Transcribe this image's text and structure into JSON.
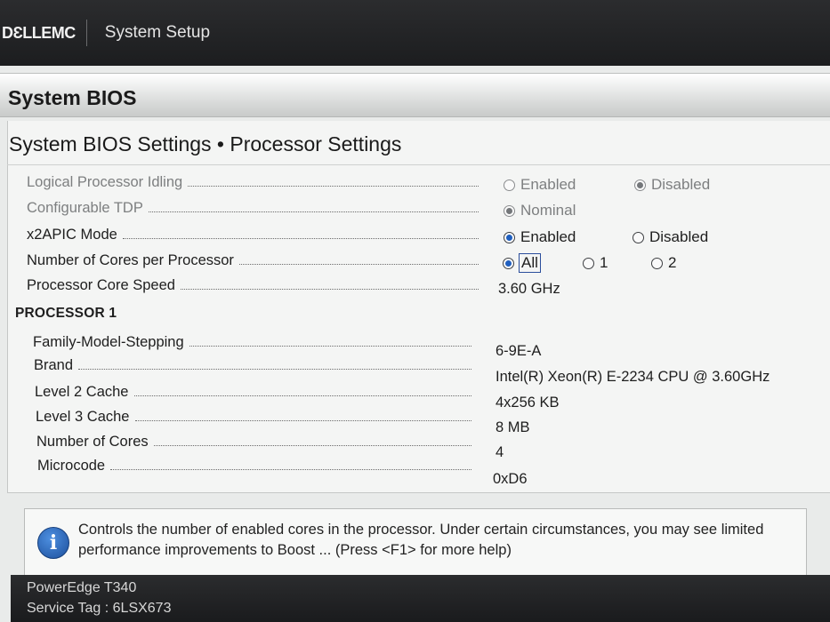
{
  "header": {
    "logo": "DƐLLEMC",
    "title": "System Setup"
  },
  "page": {
    "heading": "System BIOS",
    "breadcrumb": "System BIOS Settings • Processor Settings"
  },
  "settings": [
    {
      "label": "Logical Processor Idling",
      "options": [
        "Enabled",
        "Disabled"
      ],
      "selected": "Disabled"
    },
    {
      "label": "Configurable TDP",
      "options": [
        "Nominal"
      ],
      "selected": "Nominal"
    },
    {
      "label": "x2APIC Mode",
      "options": [
        "Enabled",
        "Disabled"
      ],
      "selected": "Enabled"
    },
    {
      "label": "Number of Cores per Processor",
      "options": [
        "All",
        "1",
        "2"
      ],
      "selected": "All"
    },
    {
      "label": "Processor Core Speed",
      "value": "3.60 GHz"
    }
  ],
  "processor1": {
    "title": "PROCESSOR 1",
    "rows": [
      {
        "label": "Family-Model-Stepping",
        "value": "6-9E-A"
      },
      {
        "label": "Brand",
        "value": "Intel(R) Xeon(R) E-2234 CPU @ 3.60GHz"
      },
      {
        "label": "Level 2 Cache",
        "value": "4x256 KB"
      },
      {
        "label": "Level 3 Cache",
        "value": "8 MB"
      },
      {
        "label": "Number of Cores",
        "value": "4"
      },
      {
        "label": "Microcode",
        "value": "0xD6"
      }
    ]
  },
  "help": {
    "icon": "info-icon",
    "text": "Controls the number of enabled cores in the processor. Under certain circumstances, you may see limited performance improvements to Boost ... (Press <F1> for more help)"
  },
  "footer": {
    "model": "PowerEdge T340",
    "service_tag": "Service Tag : 6LSX673"
  },
  "colors": {
    "radio_selected": "#1f5fbf",
    "info_icon": "#1c4f9c",
    "topbar": "#1c1d1f"
  }
}
